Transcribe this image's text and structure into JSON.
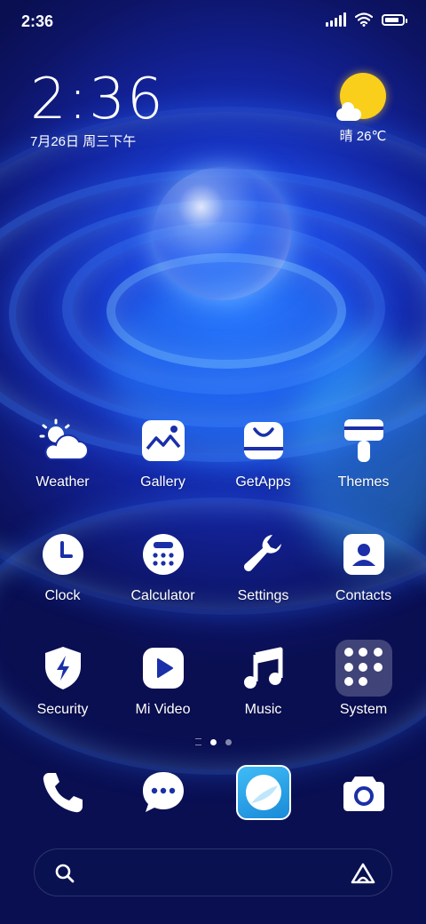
{
  "status_bar": {
    "time": "2:36",
    "battery_level": 0.85
  },
  "clock_widget": {
    "time": "2:36",
    "date": "7月26日 周三下午"
  },
  "weather_widget": {
    "condition_temp": "晴 26℃",
    "icon": "sunny-cloud-icon",
    "sun_color": "#f9cf1c"
  },
  "apps": [
    {
      "label": "Weather",
      "icon": "weather-icon"
    },
    {
      "label": "Gallery",
      "icon": "gallery-icon"
    },
    {
      "label": "GetApps",
      "icon": "getapps-icon"
    },
    {
      "label": "Themes",
      "icon": "themes-icon"
    },
    {
      "label": "Clock",
      "icon": "clock-icon"
    },
    {
      "label": "Calculator",
      "icon": "calculator-icon"
    },
    {
      "label": "Settings",
      "icon": "settings-icon"
    },
    {
      "label": "Contacts",
      "icon": "contacts-icon"
    },
    {
      "label": "Security",
      "icon": "security-icon"
    },
    {
      "label": "Mi Video",
      "icon": "mi-video-icon"
    },
    {
      "label": "Music",
      "icon": "music-icon"
    },
    {
      "label": "System",
      "icon": "folder-icon"
    }
  ],
  "pager": {
    "pages": 2,
    "current": 1
  },
  "dock": [
    {
      "icon": "phone-icon"
    },
    {
      "icon": "messages-icon"
    },
    {
      "icon": "browser-icon",
      "color": "#2ea8ee"
    },
    {
      "icon": "camera-icon"
    }
  ],
  "search": {
    "placeholder": ""
  },
  "colors": {
    "background": "#13239a",
    "accent": "#2a6bff"
  }
}
